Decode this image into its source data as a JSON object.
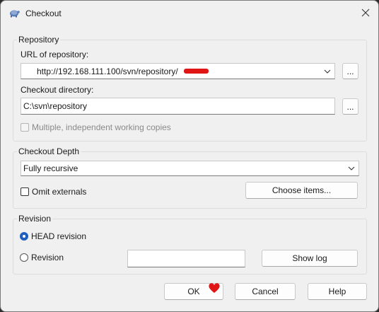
{
  "window": {
    "title": "Checkout",
    "app_icon": "tortoisesvn-icon",
    "close_icon": "close-icon"
  },
  "repository": {
    "group_label": "Repository",
    "url_label": "URL of repository:",
    "url_value": "http://192.168.111.100/svn/repository/",
    "url_browse_label": "...",
    "dir_label": "Checkout directory:",
    "dir_value": "C:\\svn\\repository",
    "dir_browse_label": "...",
    "multiple_label": "Multiple, independent working copies",
    "multiple_checked": false
  },
  "checkout_depth": {
    "group_label": "Checkout Depth",
    "depth_value": "Fully recursive",
    "omit_externals_label": "Omit externals",
    "omit_externals_checked": false,
    "choose_items_label": "Choose items..."
  },
  "revision": {
    "group_label": "Revision",
    "head_label": "HEAD revision",
    "head_selected": true,
    "revision_label": "Revision",
    "revision_value": "",
    "show_log_label": "Show log"
  },
  "buttons": {
    "ok_label": "OK",
    "cancel_label": "Cancel",
    "help_label": "Help"
  },
  "colors": {
    "accent": "#1f5fbf",
    "redaction_mark": "#e01515"
  }
}
